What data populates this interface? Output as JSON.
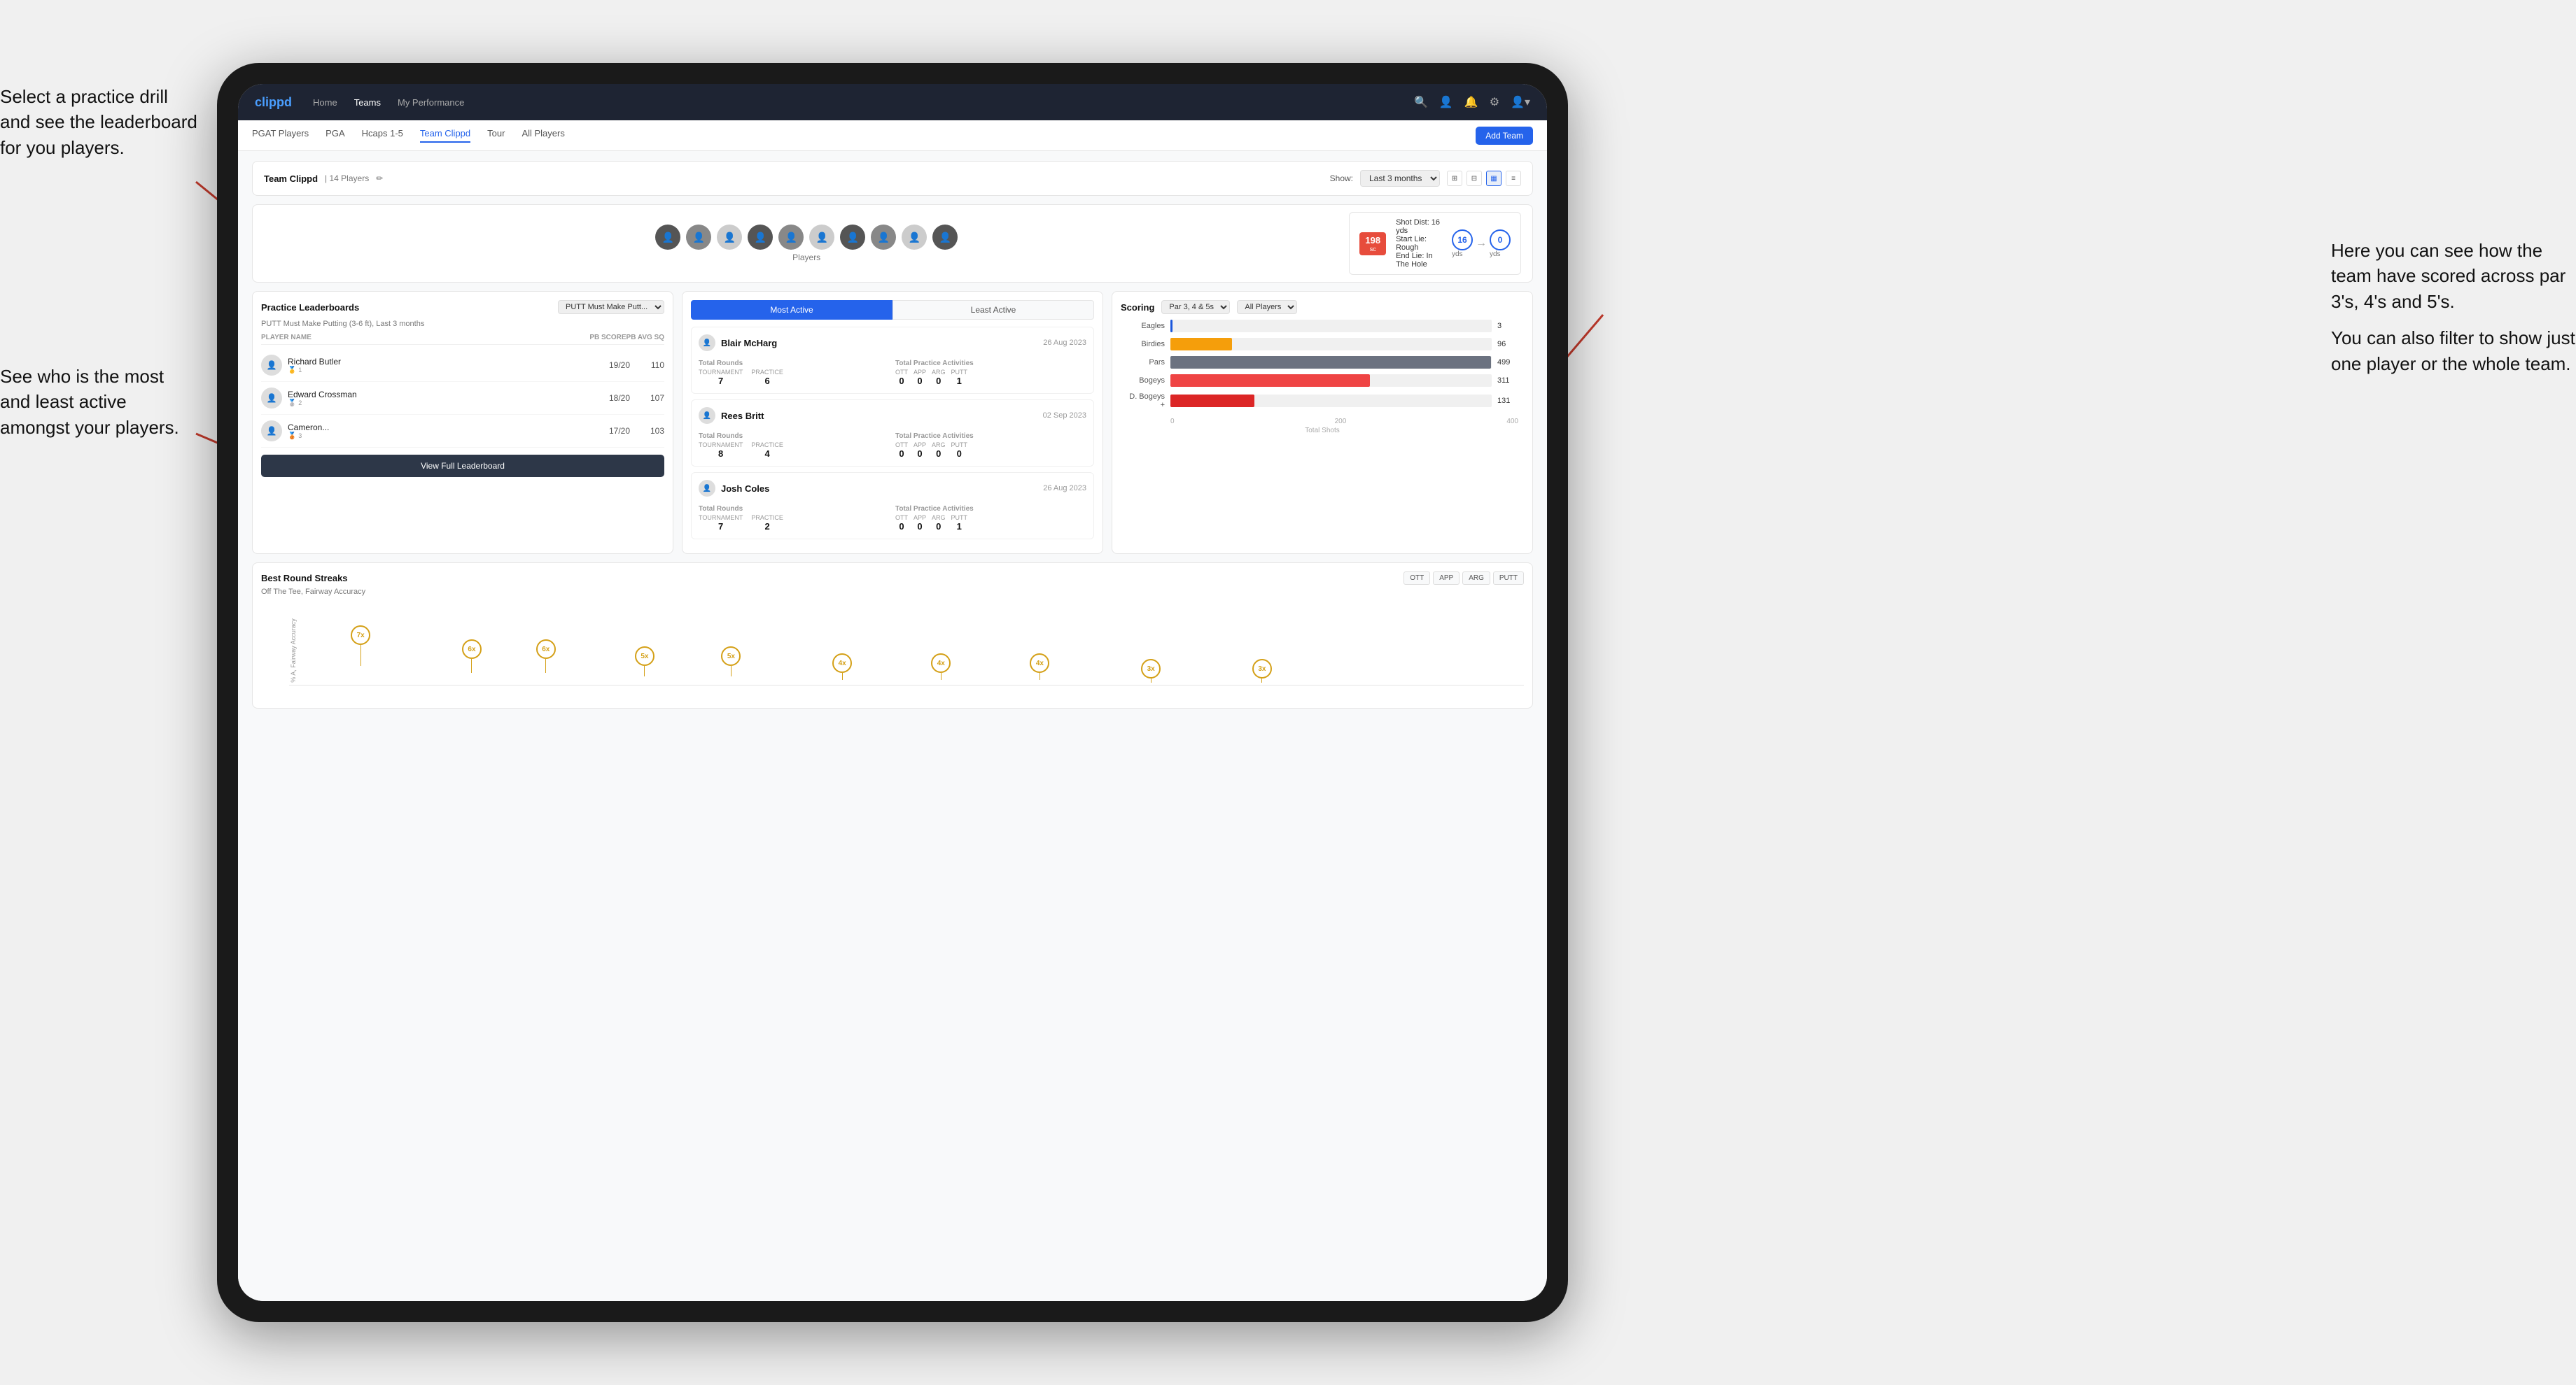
{
  "annotations": {
    "ann1": "Select a practice drill and see the leaderboard for you players.",
    "ann2": "See who is the most and least active amongst your players.",
    "ann3_line1": "Here you can see how the team have scored across par 3's, 4's and 5's.",
    "ann3_line2": "You can also filter to show just one player or the whole team."
  },
  "navbar": {
    "logo": "clippd",
    "links": [
      "Home",
      "Teams",
      "My Performance"
    ],
    "active_link": "Teams"
  },
  "subnav": {
    "links": [
      "PGAT Players",
      "PGA",
      "Hcaps 1-5",
      "Team Clippd",
      "Tour",
      "All Players"
    ],
    "active_link": "Team Clippd",
    "add_team_label": "Add Team"
  },
  "team_header": {
    "name": "Team Clippd",
    "count": "14 Players",
    "show_label": "Show:",
    "period": "Last 3 months",
    "view_icons": [
      "⊞",
      "⊟",
      "⊞",
      "≡"
    ]
  },
  "shot_card": {
    "dist": "198",
    "dist_unit": "sc",
    "shot_dist_label": "Shot Dist: 16 yds",
    "start_lie": "Start Lie: Rough",
    "end_lie": "End Lie: In The Hole",
    "yds_left": "16",
    "yds_right": "0",
    "yds_label": "yds"
  },
  "practice_leaderboards": {
    "title": "Practice Leaderboards",
    "selected_drill": "PUTT Must Make Putt...",
    "subtitle": "PUTT Must Make Putting (3-6 ft), Last 3 months",
    "table_headers": [
      "PLAYER NAME",
      "PB SCORE",
      "PB AVG SQ"
    ],
    "players": [
      {
        "rank": 1,
        "name": "Richard Butler",
        "medal": "gold",
        "score": "19/20",
        "avg": "110"
      },
      {
        "rank": 2,
        "name": "Edward Crossman",
        "medal": "silver",
        "score": "18/20",
        "avg": "107"
      },
      {
        "rank": 3,
        "name": "Cameron...",
        "medal": "bronze",
        "score": "17/20",
        "avg": "103"
      }
    ],
    "view_full_label": "View Full Leaderboard"
  },
  "activity": {
    "tabs": [
      "Most Active",
      "Least Active"
    ],
    "active_tab": "Most Active",
    "players": [
      {
        "name": "Blair McHarg",
        "date": "26 Aug 2023",
        "total_rounds_label": "Total Rounds",
        "tournament": "7",
        "practice": "6",
        "total_practice_label": "Total Practice Activities",
        "ott": "0",
        "app": "0",
        "arg": "0",
        "putt": "1"
      },
      {
        "name": "Rees Britt",
        "date": "02 Sep 2023",
        "total_rounds_label": "Total Rounds",
        "tournament": "8",
        "practice": "4",
        "total_practice_label": "Total Practice Activities",
        "ott": "0",
        "app": "0",
        "arg": "0",
        "putt": "0"
      },
      {
        "name": "Josh Coles",
        "date": "26 Aug 2023",
        "total_rounds_label": "Total Rounds",
        "tournament": "7",
        "practice": "2",
        "total_practice_label": "Total Practice Activities",
        "ott": "0",
        "app": "0",
        "arg": "0",
        "putt": "1"
      }
    ]
  },
  "scoring": {
    "title": "Scoring",
    "filter1": "Par 3, 4 & 5s",
    "filter2": "All Players",
    "bars": [
      {
        "label": "Eagles",
        "value": 3,
        "max": 500,
        "class": "eagles"
      },
      {
        "label": "Birdies",
        "value": 96,
        "max": 500,
        "class": "birdies"
      },
      {
        "label": "Pars",
        "value": 499,
        "max": 500,
        "class": "pars"
      },
      {
        "label": "Bogeys",
        "value": 311,
        "max": 500,
        "class": "bogeys"
      },
      {
        "label": "D. Bogeys +",
        "value": 131,
        "max": 500,
        "class": "dbogeys"
      }
    ],
    "axis_labels": [
      "0",
      "200",
      "400"
    ],
    "axis_title": "Total Shots"
  },
  "streaks": {
    "title": "Best Round Streaks",
    "subtitle": "Off The Tee, Fairway Accuracy",
    "buttons": [
      "OTT",
      "APP",
      "ARG",
      "PUTT"
    ],
    "dots": [
      {
        "x": 8,
        "label": "7x"
      },
      {
        "x": 14,
        "label": "6x"
      },
      {
        "x": 20,
        "label": "6x"
      },
      {
        "x": 26,
        "label": "5x"
      },
      {
        "x": 32,
        "label": "5x"
      },
      {
        "x": 38,
        "label": "4x"
      },
      {
        "x": 44,
        "label": "4x"
      },
      {
        "x": 50,
        "label": "4x"
      },
      {
        "x": 56,
        "label": "3x"
      },
      {
        "x": 62,
        "label": "3x"
      }
    ]
  },
  "players_section": {
    "label": "Players",
    "count": 10
  }
}
